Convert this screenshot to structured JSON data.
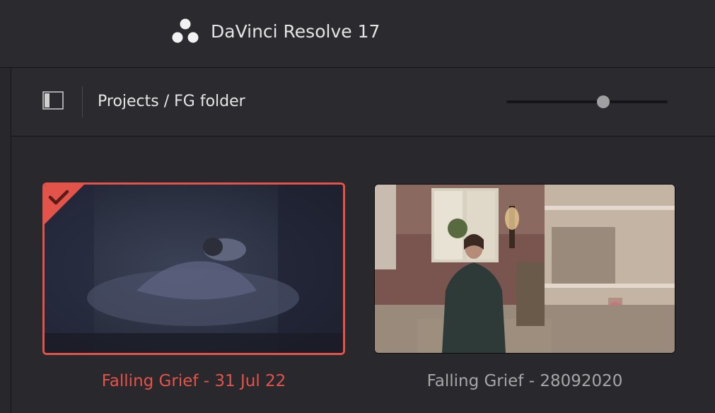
{
  "app": {
    "title": "DaVinci Resolve 17",
    "logo_icon": "davinci-resolve-logo-icon"
  },
  "toolbar": {
    "panel_toggle_icon": "sidebar-toggle-icon",
    "breadcrumb": "Projects / FG folder",
    "thumbnail_size_slider": 0.6
  },
  "projects": [
    {
      "title": "Falling Grief - 31 Jul 22",
      "selected": true,
      "badge_icon": "checkmark-icon"
    },
    {
      "title": "Falling Grief - 28092020",
      "selected": false
    }
  ],
  "colors": {
    "accent": "#e2534a",
    "selected_title": "#e2534a",
    "unselected_title": "#a6a6a6",
    "text": "#e4e4e4"
  }
}
